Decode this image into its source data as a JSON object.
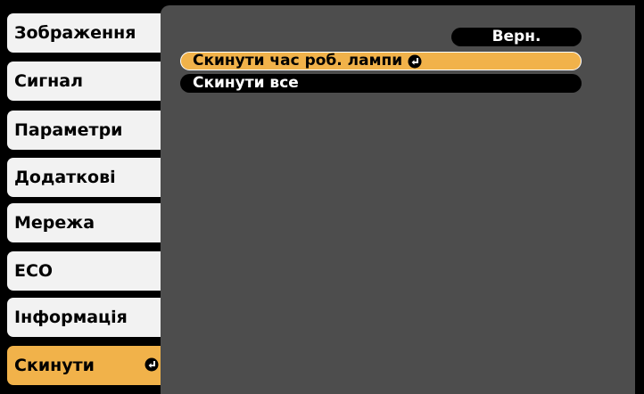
{
  "sidebar": {
    "items": [
      {
        "label": "Зображення"
      },
      {
        "label": "Сигнал"
      },
      {
        "label": "Параметри"
      },
      {
        "label": "Додаткові"
      },
      {
        "label": "Мережа"
      },
      {
        "label": "ECO"
      },
      {
        "label": "Інформація"
      },
      {
        "label": "Скинути",
        "selected": true,
        "icon": "enter-icon"
      }
    ]
  },
  "content": {
    "return_button": "Верн.",
    "menu": [
      {
        "label": "Скинути час роб. лампи",
        "selected": true,
        "icon": "enter-icon"
      },
      {
        "label": "Скинути все"
      }
    ]
  },
  "colors": {
    "highlight": "#f1b24a",
    "panel": "#4d4d4d",
    "tab": "#f2f2f2",
    "background": "#000000"
  }
}
